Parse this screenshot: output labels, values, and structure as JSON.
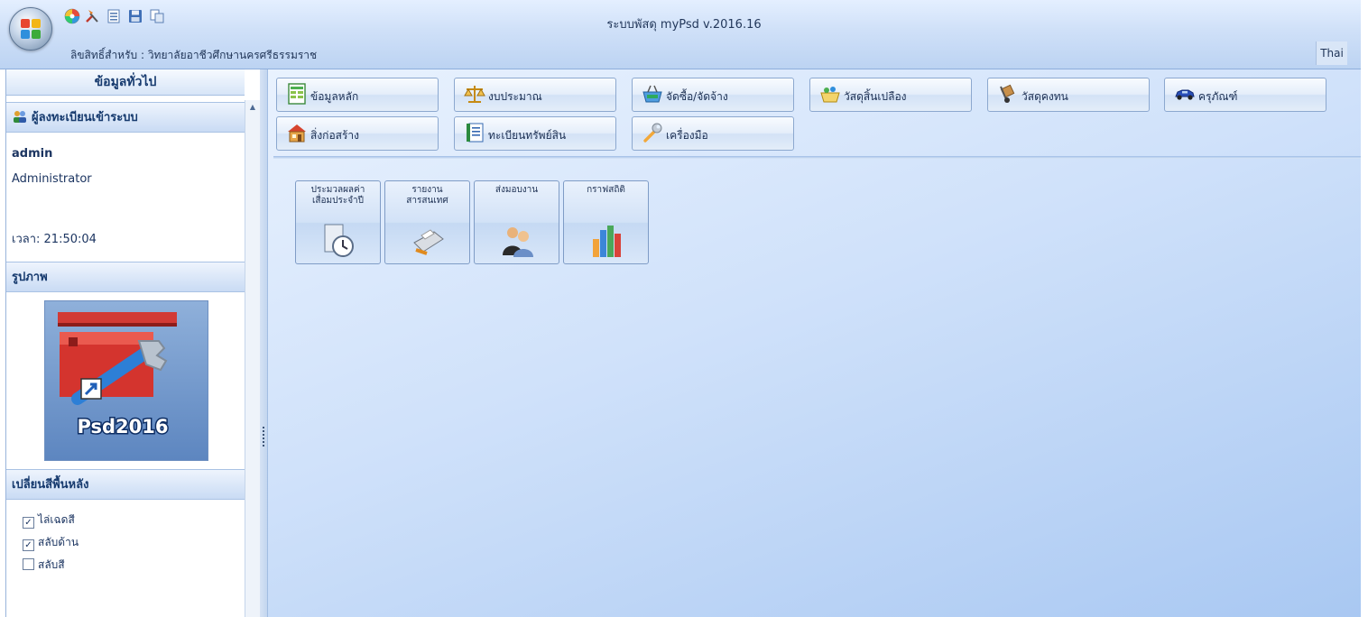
{
  "window": {
    "title": "ระบบพัสดุ myPsd v.2016.16",
    "license": "ลิขสิทธิ์สำหรับ : วิทยาลัยอาชีวศึกษานครศรีธรรมราช",
    "language": "Thai"
  },
  "quick_access": [
    "color-wheel-icon",
    "tools-icon",
    "list-icon",
    "save-icon",
    "copy-icon"
  ],
  "left_panel": {
    "title": "ข้อมูลทั่วไป",
    "login_section": "ผู้ลงทะเบียนเข้าระบบ",
    "user_name": "admin",
    "user_role": "Administrator",
    "time": "เวลา: 21:50:04",
    "picture_section": "รูปภาพ",
    "shortcut_label": "Psd2016",
    "background_section": "เปลี่ยนสีพื้นหลัง",
    "options": [
      {
        "label": "ไล่เฉดสี",
        "checked": true
      },
      {
        "label": "สลับด้าน",
        "checked": true
      },
      {
        "label": "สลับสี",
        "checked": false
      }
    ]
  },
  "modules": [
    {
      "label": "ข้อมูลหลัก",
      "icon": "spreadsheet-icon"
    },
    {
      "label": "งบประมาณ",
      "icon": "scales-icon"
    },
    {
      "label": "จัดซื้อ/จัดจ้าง",
      "icon": "basket-icon"
    },
    {
      "label": "วัสดุสิ้นเปลือง",
      "icon": "supplies-basket-icon"
    },
    {
      "label": "วัสดุคงทน",
      "icon": "hand-truck-icon"
    },
    {
      "label": "ครุภัณฑ์",
      "icon": "car-icon"
    },
    {
      "label": "สิ่งก่อสร้าง",
      "icon": "building-icon"
    },
    {
      "label": "ทะเบียนทรัพย์สิน",
      "icon": "ledger-icon"
    },
    {
      "label": "เครื่องมือ",
      "icon": "wrench-icon"
    }
  ],
  "tiles": [
    {
      "label": "ประมวลผลค่า\nเสื่อมประจำปี",
      "icon": "clock-document-icon"
    },
    {
      "label": "รายงาน\nสารสนเทศ",
      "icon": "printer-icon"
    },
    {
      "label": "ส่งมอบงาน",
      "icon": "users-icon"
    },
    {
      "label": "กราฟสถิติ",
      "icon": "bar-chart-icon"
    }
  ],
  "colors": {
    "accent": "#1c3561",
    "ribbon": "#cfe0f8",
    "panel_header": "#c9dbf4"
  }
}
